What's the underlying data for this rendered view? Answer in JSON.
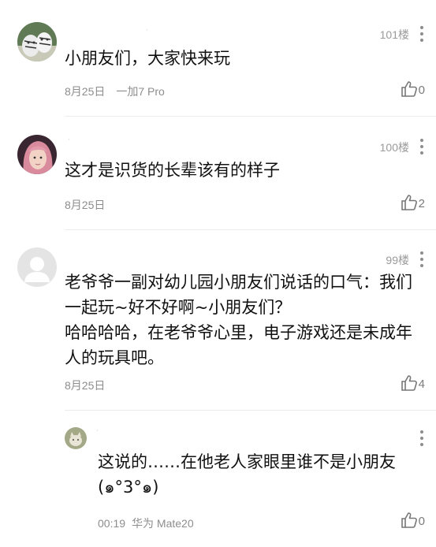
{
  "comments": [
    {
      "floor": "101楼",
      "text": "小朋友们，大家快来玩",
      "date": "8月25日",
      "device": "一加7 Pro",
      "likes": "0"
    },
    {
      "floor": "100楼",
      "text": "这才是识货的长辈该有的样子",
      "date": "8月25日",
      "device": "",
      "likes": "2"
    },
    {
      "floor": "99楼",
      "text": "老爷爷一副对幼儿园小朋友们说话的口气：我们\n一起玩~好不好啊~小朋友们？\n哈哈哈哈，在老爷爷心里，电子游戏还是未成年\n人的玩具吧。",
      "date": "8月25日",
      "device": "",
      "likes": "4"
    }
  ],
  "reply": {
    "text": "这说的……在他老人家眼里谁不是小朋友\n(๑°3°๑)",
    "time": "00:19",
    "device": "华为 Mate20",
    "likes": "0"
  },
  "colors": {
    "meta": "#8d8d8d",
    "text": "#111111",
    "divider": "#ececec"
  },
  "icons": [
    "tiger-avatar",
    "anime-girl-avatar",
    "default-user-avatar",
    "cat-avatar",
    "thumbs-up-icon",
    "more-dots-icon"
  ]
}
